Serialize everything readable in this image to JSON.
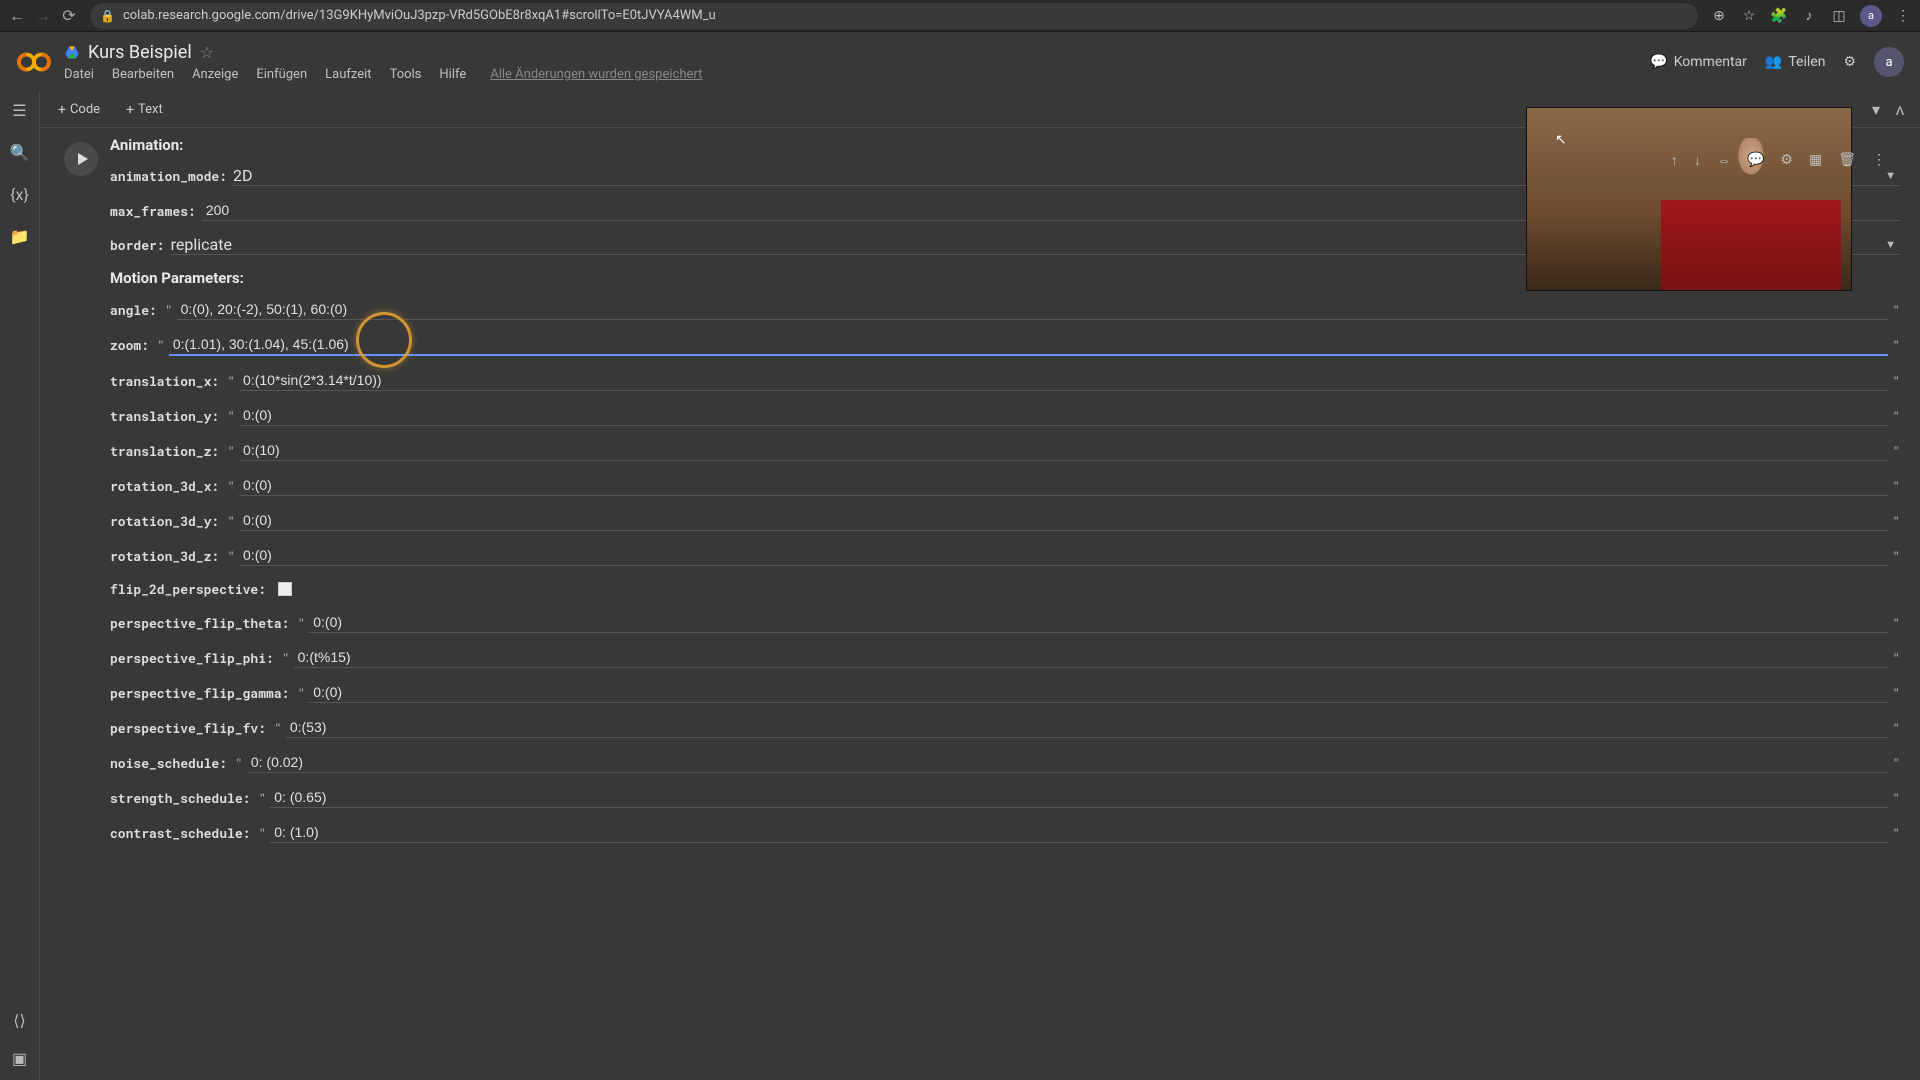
{
  "browser": {
    "url": "colab.research.google.com/drive/13G9KHyMviOuJ3pzp-VRd5GObE8r8xqA1#scrollTo=E0tJVYA4WM_u",
    "avatar": "a"
  },
  "header": {
    "title": "Kurs Beispiel",
    "menu": [
      "Datei",
      "Bearbeiten",
      "Anzeige",
      "Einfügen",
      "Laufzeit",
      "Tools",
      "Hilfe"
    ],
    "saved": "Alle Änderungen wurden gespeichert",
    "kommentar": "Kommentar",
    "teilen": "Teilen",
    "avatar": "a"
  },
  "toolbar": {
    "code": "Code",
    "text": "Text"
  },
  "sections": {
    "animation_title": "Animation:",
    "motion_title": "Motion Parameters:"
  },
  "params": {
    "animation_mode": {
      "label": "animation_mode:",
      "value": "2D"
    },
    "max_frames": {
      "label": "max_frames:",
      "value": "200"
    },
    "border": {
      "label": "border:",
      "value": "replicate"
    },
    "angle": {
      "label": "angle:",
      "value": "0:(0), 20:(-2), 50:(1), 60:(0)"
    },
    "zoom": {
      "label": "zoom:",
      "value": "0:(1.01), 30:(1.04), 45:(1.06)"
    },
    "translation_x": {
      "label": "translation_x:",
      "value": "0:(10*sin(2*3.14*t/10))"
    },
    "translation_y": {
      "label": "translation_y:",
      "value": "0:(0)"
    },
    "translation_z": {
      "label": "translation_z:",
      "value": "0:(10)"
    },
    "rotation_3d_x": {
      "label": "rotation_3d_x:",
      "value": "0:(0)"
    },
    "rotation_3d_y": {
      "label": "rotation_3d_y:",
      "value": "0:(0)"
    },
    "rotation_3d_z": {
      "label": "rotation_3d_z:",
      "value": "0:(0)"
    },
    "flip_2d_perspective": {
      "label": "flip_2d_perspective:"
    },
    "perspective_flip_theta": {
      "label": "perspective_flip_theta:",
      "value": "0:(0)"
    },
    "perspective_flip_phi": {
      "label": "perspective_flip_phi:",
      "value": "0:(t%15)"
    },
    "perspective_flip_gamma": {
      "label": "perspective_flip_gamma:",
      "value": "0:(0)"
    },
    "perspective_flip_fv": {
      "label": "perspective_flip_fv:",
      "value": "0:(53)"
    },
    "noise_schedule": {
      "label": "noise_schedule:",
      "value": "0: (0.02)"
    },
    "strength_schedule": {
      "label": "strength_schedule:",
      "value": "0: (0.65)"
    },
    "contrast_schedule": {
      "label": "contrast_schedule:",
      "value": "0: (1.0)"
    }
  }
}
